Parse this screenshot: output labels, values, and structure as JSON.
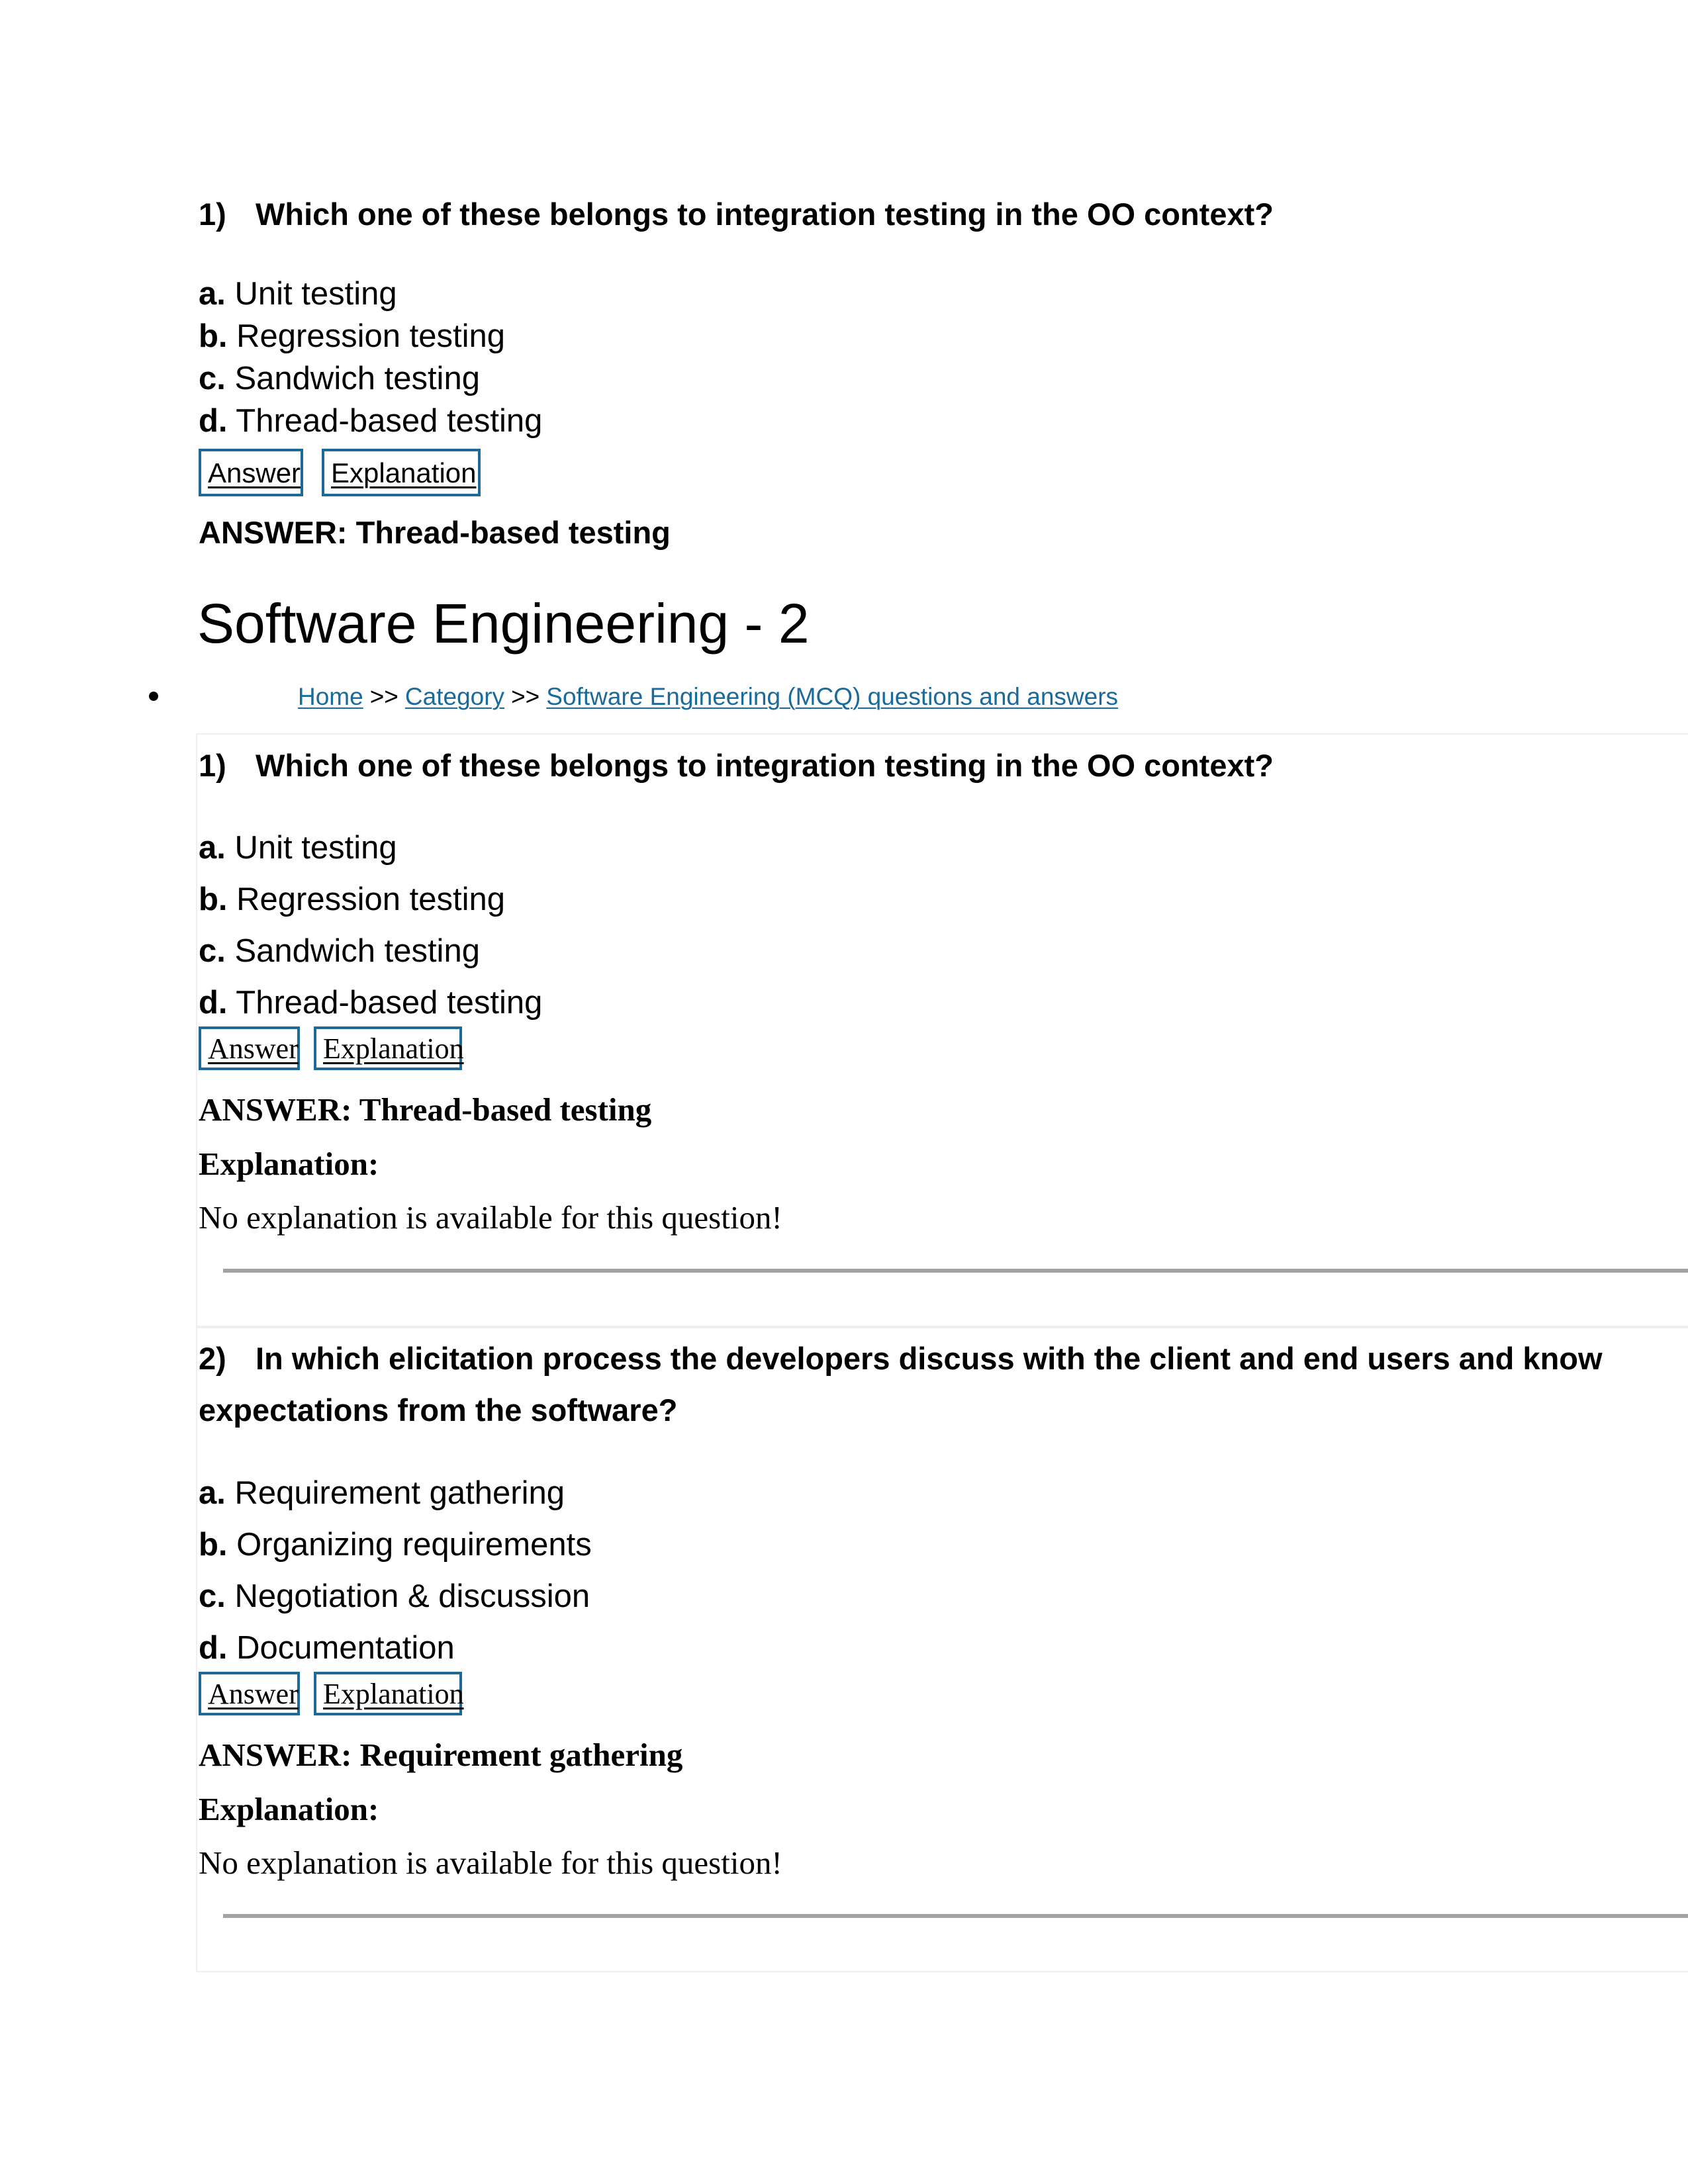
{
  "top_question": {
    "number": "1)",
    "text": "Which one of these belongs to integration testing in the OO context?",
    "options": [
      {
        "letter": "a.",
        "text": "Unit testing"
      },
      {
        "letter": "b.",
        "text": "Regression testing"
      },
      {
        "letter": "c.",
        "text": "Sandwich testing"
      },
      {
        "letter": "d.",
        "text": "Thread-based testing"
      }
    ],
    "answer_button": "Answer",
    "explanation_button": "Explanation",
    "answer_text": "ANSWER: Thread-based testing"
  },
  "page_title": "Software Engineering - 2",
  "breadcrumb": {
    "items": [
      "Home",
      "Category",
      "Software Engineering (MCQ) questions and answers"
    ],
    "separator": ">>"
  },
  "link_color": "#1a6a9a",
  "button_border_color": "#1d6a98",
  "questions": [
    {
      "number": "1)",
      "text": "Which one of these belongs to integration testing in the OO context?",
      "options": [
        {
          "letter": "a.",
          "text": "Unit testing"
        },
        {
          "letter": "b.",
          "text": "Regression testing"
        },
        {
          "letter": "c.",
          "text": "Sandwich testing"
        },
        {
          "letter": "d.",
          "text": "Thread-based testing"
        }
      ],
      "answer_button": "Answer",
      "explanation_button": "Explanation",
      "answer_text": "ANSWER: Thread-based testing",
      "explanation_label": "Explanation:",
      "explanation_text": "No explanation is available for this question!"
    },
    {
      "number": "2)",
      "text_line1": "In which elicitation process the developers discuss with the client and end users and know",
      "text_line2": "expectations from the software?",
      "options": [
        {
          "letter": "a.",
          "text": "Requirement gathering"
        },
        {
          "letter": "b.",
          "text": "Organizing requirements"
        },
        {
          "letter": "c.",
          "text": "Negotiation & discussion"
        },
        {
          "letter": "d.",
          "text": "Documentation"
        }
      ],
      "answer_button": "Answer",
      "explanation_button": "Explanation",
      "answer_text": "ANSWER: Requirement gathering",
      "explanation_label": "Explanation:",
      "explanation_text": "No explanation is available for this question!"
    }
  ]
}
